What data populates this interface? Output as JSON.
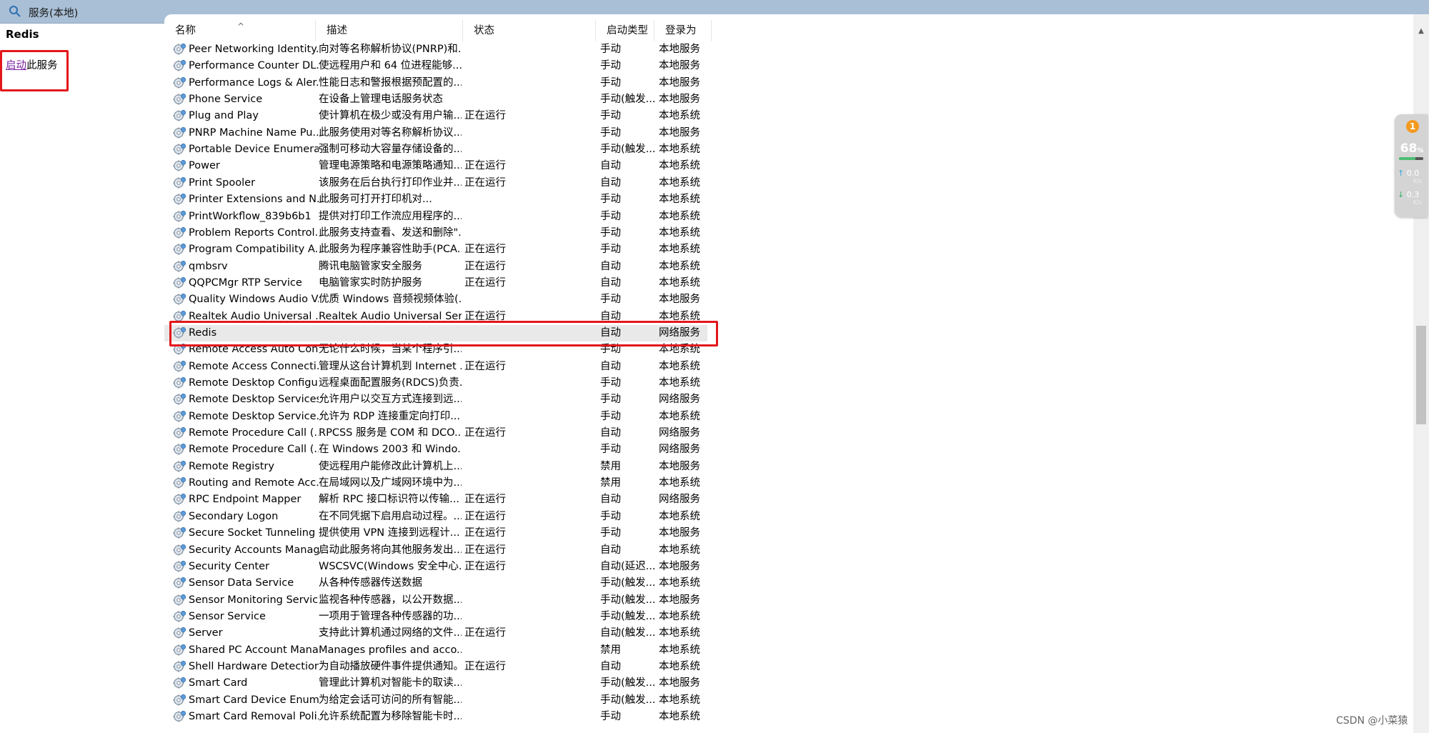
{
  "window": {
    "title": "服务(本地)"
  },
  "left_pane": {
    "service_name": "Redis",
    "action_link": "启动",
    "action_suffix": "此服务"
  },
  "columns": {
    "name": "名称",
    "desc": "描述",
    "status": "状态",
    "startup": "启动类型",
    "logon": "登录为"
  },
  "rows": [
    {
      "name": "Peer Networking Identity...",
      "desc": "向对等名称解析协议(PNRP)和...",
      "status": "",
      "startup": "手动",
      "logon": "本地服务"
    },
    {
      "name": "Performance Counter DL...",
      "desc": "使远程用户和 64 位进程能够...",
      "status": "",
      "startup": "手动",
      "logon": "本地服务"
    },
    {
      "name": "Performance Logs & Aler...",
      "desc": "性能日志和警报根据预配置的...",
      "status": "",
      "startup": "手动",
      "logon": "本地服务"
    },
    {
      "name": "Phone Service",
      "desc": "在设备上管理电话服务状态",
      "status": "",
      "startup": "手动(触发...",
      "logon": "本地服务"
    },
    {
      "name": "Plug and Play",
      "desc": "使计算机在极少或没有用户输...",
      "status": "正在运行",
      "startup": "手动",
      "logon": "本地系统"
    },
    {
      "name": "PNRP Machine Name Pu...",
      "desc": "此服务使用对等名称解析协议...",
      "status": "",
      "startup": "手动",
      "logon": "本地服务"
    },
    {
      "name": "Portable Device Enumera...",
      "desc": "强制可移动大容量存储设备的...",
      "status": "",
      "startup": "手动(触发...",
      "logon": "本地系统"
    },
    {
      "name": "Power",
      "desc": "管理电源策略和电源策略通知...",
      "status": "正在运行",
      "startup": "自动",
      "logon": "本地系统"
    },
    {
      "name": "Print Spooler",
      "desc": "该服务在后台执行打印作业并...",
      "status": "正在运行",
      "startup": "自动",
      "logon": "本地系统"
    },
    {
      "name": "Printer Extensions and N...",
      "desc": "此服务可打开打印机对...",
      "status": "",
      "startup": "手动",
      "logon": "本地系统"
    },
    {
      "name": "PrintWorkflow_839b6b1",
      "desc": "提供对打印工作流应用程序的...",
      "status": "",
      "startup": "手动",
      "logon": "本地系统"
    },
    {
      "name": "Problem Reports Control...",
      "desc": "此服务支持查看、发送和删除\"...",
      "status": "",
      "startup": "手动",
      "logon": "本地系统"
    },
    {
      "name": "Program Compatibility A...",
      "desc": "此服务为程序兼容性助手(PCA...",
      "status": "正在运行",
      "startup": "手动",
      "logon": "本地系统"
    },
    {
      "name": "qmbsrv",
      "desc": "腾讯电脑管家安全服务",
      "status": "正在运行",
      "startup": "自动",
      "logon": "本地系统"
    },
    {
      "name": "QQPCMgr RTP Service",
      "desc": "电脑管家实时防护服务",
      "status": "正在运行",
      "startup": "自动",
      "logon": "本地系统"
    },
    {
      "name": "Quality Windows Audio V...",
      "desc": "优质 Windows 音频视频体验(...",
      "status": "",
      "startup": "手动",
      "logon": "本地服务"
    },
    {
      "name": "Realtek Audio Universal ...",
      "desc": "Realtek Audio Universal Ser...",
      "status": "正在运行",
      "startup": "自动",
      "logon": "本地系统"
    },
    {
      "name": "Redis",
      "desc": "",
      "status": "",
      "startup": "自动",
      "logon": "网络服务"
    },
    {
      "name": "Remote Access Auto Con...",
      "desc": "无论什么时候，当某个程序引...",
      "status": "",
      "startup": "手动",
      "logon": "本地系统"
    },
    {
      "name": "Remote Access Connecti...",
      "desc": "管理从这台计算机到 Internet ...",
      "status": "正在运行",
      "startup": "自动",
      "logon": "本地系统"
    },
    {
      "name": "Remote Desktop Configu...",
      "desc": "远程桌面配置服务(RDCS)负责...",
      "status": "",
      "startup": "手动",
      "logon": "本地系统"
    },
    {
      "name": "Remote Desktop Services",
      "desc": "允许用户以交互方式连接到远...",
      "status": "",
      "startup": "手动",
      "logon": "网络服务"
    },
    {
      "name": "Remote Desktop Service...",
      "desc": "允许为 RDP 连接重定向打印...",
      "status": "",
      "startup": "手动",
      "logon": "本地系统"
    },
    {
      "name": "Remote Procedure Call (...",
      "desc": "RPCSS 服务是 COM 和 DCO...",
      "status": "正在运行",
      "startup": "自动",
      "logon": "网络服务"
    },
    {
      "name": "Remote Procedure Call (...",
      "desc": "在 Windows 2003 和 Windo...",
      "status": "",
      "startup": "手动",
      "logon": "网络服务"
    },
    {
      "name": "Remote Registry",
      "desc": "使远程用户能修改此计算机上...",
      "status": "",
      "startup": "禁用",
      "logon": "本地服务"
    },
    {
      "name": "Routing and Remote Acc...",
      "desc": "在局域网以及广域网环境中为...",
      "status": "",
      "startup": "禁用",
      "logon": "本地系统"
    },
    {
      "name": "RPC Endpoint Mapper",
      "desc": "解析 RPC 接口标识符以传输...",
      "status": "正在运行",
      "startup": "自动",
      "logon": "网络服务"
    },
    {
      "name": "Secondary Logon",
      "desc": "在不同凭据下启用启动过程。...",
      "status": "正在运行",
      "startup": "手动",
      "logon": "本地系统"
    },
    {
      "name": "Secure Socket Tunneling ...",
      "desc": "提供使用 VPN 连接到远程计...",
      "status": "正在运行",
      "startup": "手动",
      "logon": "本地服务"
    },
    {
      "name": "Security Accounts Manag...",
      "desc": "启动此服务将向其他服务发出...",
      "status": "正在运行",
      "startup": "自动",
      "logon": "本地系统"
    },
    {
      "name": "Security Center",
      "desc": "WSCSVC(Windows 安全中心...",
      "status": "正在运行",
      "startup": "自动(延迟...",
      "logon": "本地服务"
    },
    {
      "name": "Sensor Data Service",
      "desc": "从各种传感器传送数据",
      "status": "",
      "startup": "手动(触发...",
      "logon": "本地系统"
    },
    {
      "name": "Sensor Monitoring Service",
      "desc": "监视各种传感器，以公开数据...",
      "status": "",
      "startup": "手动(触发...",
      "logon": "本地服务"
    },
    {
      "name": "Sensor Service",
      "desc": "一项用于管理各种传感器的功...",
      "status": "",
      "startup": "手动(触发...",
      "logon": "本地系统"
    },
    {
      "name": "Server",
      "desc": "支持此计算机通过网络的文件...",
      "status": "正在运行",
      "startup": "自动(触发...",
      "logon": "本地系统"
    },
    {
      "name": "Shared PC Account Mana...",
      "desc": "Manages profiles and acco...",
      "status": "",
      "startup": "禁用",
      "logon": "本地系统"
    },
    {
      "name": "Shell Hardware Detection",
      "desc": "为自动播放硬件事件提供通知。",
      "status": "正在运行",
      "startup": "自动",
      "logon": "本地系统"
    },
    {
      "name": "Smart Card",
      "desc": "管理此计算机对智能卡的取读...",
      "status": "",
      "startup": "手动(触发...",
      "logon": "本地服务"
    },
    {
      "name": "Smart Card Device Enum...",
      "desc": "为给定会话可访问的所有智能...",
      "status": "",
      "startup": "手动(触发...",
      "logon": "本地系统"
    },
    {
      "name": "Smart Card Removal Poli...",
      "desc": "允许系统配置为移除智能卡时...",
      "status": "",
      "startup": "手动",
      "logon": "本地系统"
    }
  ],
  "selected_index": 17,
  "widget": {
    "badge": "1",
    "percent": "68",
    "percent_unit": "%",
    "upload": "0.0",
    "upload_unit": "K/s",
    "download": "0.3",
    "download_unit": "K/s",
    "level": 0.68
  },
  "watermark": "CSDN @小菜猿",
  "colors": {
    "highlight_box": "#e3171b",
    "link": "#7a1fa2",
    "titlebar": "#a9bfd6",
    "selected_row": "#e9e9e9"
  }
}
